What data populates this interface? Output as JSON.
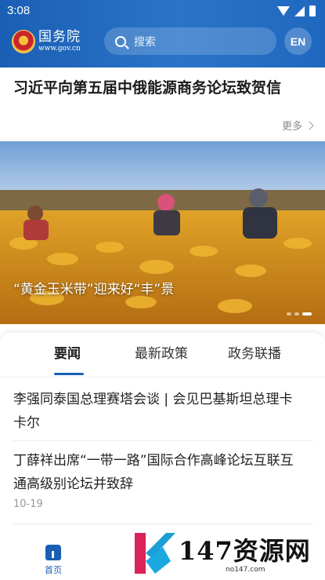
{
  "status_bar": {
    "time": "3:08"
  },
  "header": {
    "logo_name": "国务院",
    "logo_url": "www.gov.cn",
    "search_placeholder": "搜索",
    "lang_button": "EN"
  },
  "headline": {
    "title": "习近平向第五届中俄能源商务论坛致贺信",
    "more_label": "更多"
  },
  "banner": {
    "caption": "“黄金玉米带”迎来好“丰”景",
    "slide_count": 3,
    "active_slide": 3
  },
  "tabs": [
    {
      "label": "要闻",
      "active": true
    },
    {
      "label": "最新政策",
      "active": false
    },
    {
      "label": "政务联播",
      "active": false
    }
  ],
  "news": [
    {
      "title_line1": "李强同泰国总理赛塔会谈 | 会见巴基斯坦总理卡",
      "title_line2": "卡尔",
      "date": ""
    },
    {
      "title_line1": "丁薛祥出席“一带一路”国际合作高峰论坛互联互",
      "title_line2": "通高级别论坛并致辞",
      "date": "10-19"
    }
  ],
  "bottom_nav": {
    "home_label": "首页"
  },
  "watermark": {
    "text": "147资源网",
    "sub": "no147.com"
  },
  "colors": {
    "primary": "#1a5fb4",
    "text": "#222222",
    "muted": "#999999"
  }
}
